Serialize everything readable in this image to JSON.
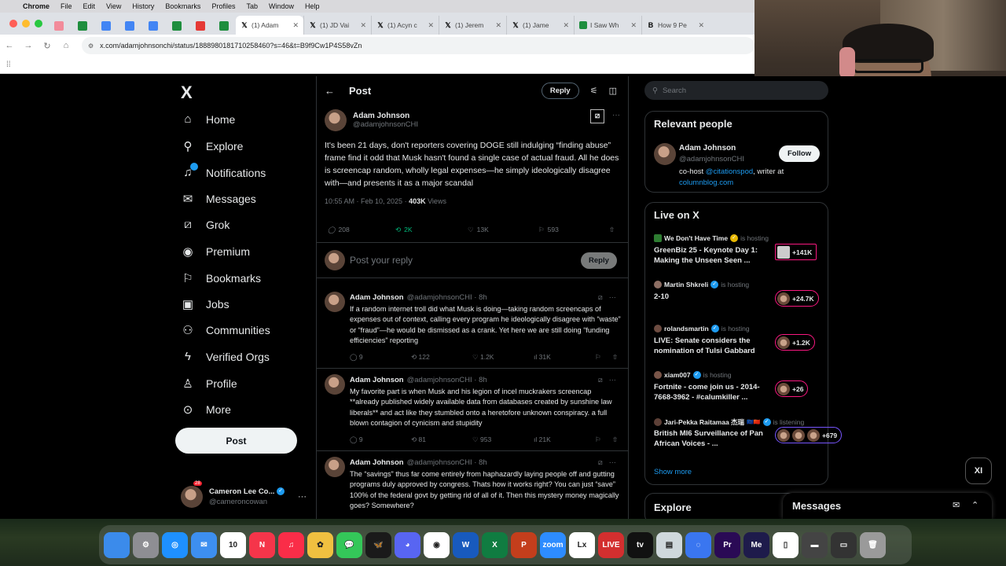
{
  "menubar": {
    "apple": "",
    "items": [
      "Chrome",
      "File",
      "Edit",
      "View",
      "History",
      "Bookmarks",
      "Profiles",
      "Tab",
      "Window",
      "Help"
    ]
  },
  "browser": {
    "tabs": [
      {
        "title": "(1) Adam",
        "active": true
      },
      {
        "title": "(1) JD Vai",
        "active": false
      },
      {
        "title": "(1) Acyn c",
        "active": false
      },
      {
        "title": "(1) Jerem",
        "active": false
      },
      {
        "title": "(1) Jame",
        "active": false
      },
      {
        "title": "I Saw Wh",
        "active": false
      },
      {
        "title": "How 9 Pe",
        "active": false
      }
    ],
    "url": "x.com/adamjohnsonchi/status/1888980181710258460?s=46&t=B9f9Cw1P4S58vZn"
  },
  "nav": {
    "logo": "X",
    "items": [
      {
        "label": "Home",
        "icon": "home-icon",
        "glyph": "⌂"
      },
      {
        "label": "Explore",
        "icon": "search-icon",
        "glyph": "⚲"
      },
      {
        "label": "Notifications",
        "icon": "bell-icon",
        "glyph": "🔔"
      },
      {
        "label": "Messages",
        "icon": "envelope-icon",
        "glyph": "✉"
      },
      {
        "label": "Grok",
        "icon": "grok-icon",
        "glyph": "⧄"
      },
      {
        "label": "Premium",
        "icon": "premium-icon",
        "glyph": "◉"
      },
      {
        "label": "Bookmarks",
        "icon": "bookmark-icon",
        "glyph": "⚑"
      },
      {
        "label": "Jobs",
        "icon": "briefcase-icon",
        "glyph": "▣"
      },
      {
        "label": "Communities",
        "icon": "communities-icon",
        "glyph": "⚇"
      },
      {
        "label": "Verified Orgs",
        "icon": "lightning-icon",
        "glyph": "ϟ"
      },
      {
        "label": "Profile",
        "icon": "person-icon",
        "glyph": "⚲"
      },
      {
        "label": "More",
        "icon": "more-circle-icon",
        "glyph": "⊙"
      }
    ],
    "post_label": "Post",
    "account": {
      "name": "Cameron Lee Co...",
      "handle": "@cameroncowan",
      "notif_count": "28"
    }
  },
  "main": {
    "title": "Post",
    "reply_label": "Reply",
    "tweet": {
      "name": "Adam Johnson",
      "handle": "@adamjohnsonCHI",
      "text": "It's been 21 days, don't reporters covering DOGE still indulging “finding abuse” frame find it odd that Musk hasn't found a single case of actual fraud. All he does is screencap random, wholly legal expenses—he simply ideologically disagree with—and presents it as a major scandal",
      "time": "10:55 AM · Feb 10, 2025 · ",
      "views": "403K",
      "views_label": " Views",
      "replies": "208",
      "reposts": "2K",
      "likes": "13K",
      "bookmarks": "593"
    },
    "composer": {
      "placeholder": "Post your reply",
      "button": "Reply"
    },
    "replies": [
      {
        "name": "Adam Johnson",
        "handle": "@adamjohnsonCHI · 8h",
        "text": "If a random internet troll did what Musk is doing—taking random screencaps of expenses out of context, calling every program he ideologically disagree with “waste” or “fraud”—he would be dismissed as a crank. Yet here we are still doing “funding efficiencies” reporting",
        "replies": "9",
        "reposts": "122",
        "likes": "1.2K",
        "views": "31K"
      },
      {
        "name": "Adam Johnson",
        "handle": "@adamjohnsonCHI · 8h",
        "text": "My favorite part is when Musk and his legion of incel muckrakers screencap **already published widely available data from databases created by sunshine law liberals** and act like they stumbled onto a heretofore unknown conspiracy. a full blown contagion of cynicism and stupidity",
        "replies": "9",
        "reposts": "81",
        "likes": "953",
        "views": "21K"
      },
      {
        "name": "Adam Johnson",
        "handle": "@adamjohnsonCHI · 8h",
        "text": "The “savings” thus far come entirely from haphazardly laying people off and gutting programs duly approved by congress. Thats how it works right? You can just “save” 100% of the federal govt by getting rid of all of it. Then this mystery money magically goes? Somewhere?",
        "replies": "",
        "reposts": "",
        "likes": "",
        "views": ""
      }
    ]
  },
  "right": {
    "search_placeholder": "Search",
    "relevant": {
      "heading": "Relevant people",
      "name": "Adam Johnson",
      "handle": "@adamjohnsonCHI",
      "follow": "Follow",
      "bio_prefix": "co-host ",
      "bio_link1": "@citationspod",
      "bio_mid": ", writer at",
      "bio_link2": "columnblog.com"
    },
    "live": {
      "heading": "Live on X",
      "items": [
        {
          "host": "We Don't Have Time",
          "status": "is hosting",
          "title": "GreenBiz 25 - Keynote Day 1: Making the Unseen Seen ...",
          "count": "+141K",
          "color": "pink"
        },
        {
          "host": "Martin Shkreli",
          "status": "is hosting",
          "title": "2-10",
          "count": "+24.7K",
          "color": "pink"
        },
        {
          "host": "rolandsmartin",
          "status": "is hosting",
          "title": "LIVE: Senate considers the nomination of Tulsi Gabbard",
          "count": "+1.2K",
          "color": "pink"
        },
        {
          "host": "xiam007",
          "status": "is hosting",
          "title": "Fortnite - come join us - 2014-7668-3962 - #calumkiller ...",
          "count": "+26",
          "color": "pink"
        },
        {
          "host": "Jari-Pekka Raitamaa 杰瑞",
          "status": "is listening",
          "title": "British MI6 Surveillance of Pan African Voices - ...",
          "count": "+679",
          "color": "purple"
        }
      ],
      "show_more": "Show more"
    },
    "explore": "Explore",
    "messages": "Messages"
  },
  "grok_fab": "XI",
  "dock": [
    {
      "name": "finder-icon",
      "color": "#3b8beb",
      "label": ""
    },
    {
      "name": "settings-icon",
      "color": "#8e8e93",
      "label": "⚙"
    },
    {
      "name": "safari-icon",
      "color": "#1e90ff",
      "label": "◎"
    },
    {
      "name": "mail-icon",
      "color": "#3d8ff0",
      "label": "✉"
    },
    {
      "name": "calendar-icon",
      "color": "#ffffff",
      "label": "10"
    },
    {
      "name": "news-icon",
      "color": "#f5354a",
      "label": "N"
    },
    {
      "name": "music-icon",
      "color": "#fa2d48",
      "label": "♫"
    },
    {
      "name": "photos-icon",
      "color": "#f0c040",
      "label": "✿"
    },
    {
      "name": "messages-icon",
      "color": "#34c759",
      "label": "💬"
    },
    {
      "name": "butterfly-icon",
      "color": "#1a1a1a",
      "label": "🦋"
    },
    {
      "name": "discord-icon",
      "color": "#5865f2",
      "label": "◕"
    },
    {
      "name": "chrome-icon",
      "color": "#ffffff",
      "label": "◉"
    },
    {
      "name": "word-icon",
      "color": "#185abd",
      "label": "W"
    },
    {
      "name": "excel-icon",
      "color": "#107c41",
      "label": "X"
    },
    {
      "name": "powerpoint-icon",
      "color": "#c43e1c",
      "label": "P"
    },
    {
      "name": "zoom-icon",
      "color": "#2d8cff",
      "label": "zoom"
    },
    {
      "name": "lx-icon",
      "color": "#ffffff",
      "label": "Lx"
    },
    {
      "name": "live-icon",
      "color": "#d32f2f",
      "label": "LIVE"
    },
    {
      "name": "appletv-icon",
      "color": "#111111",
      "label": "tv"
    },
    {
      "name": "preview-icon",
      "color": "#cfd8dc",
      "label": "▤"
    },
    {
      "name": "signal-icon",
      "color": "#3a76f0",
      "label": "◌"
    },
    {
      "name": "premiere-icon",
      "color": "#2a0a55",
      "label": "Pr"
    },
    {
      "name": "media-encoder-icon",
      "color": "#1e1b4b",
      "label": "Me"
    },
    {
      "name": "document-icon",
      "color": "#ffffff",
      "label": "▯"
    },
    {
      "name": "folder-icon",
      "color": "#444444",
      "label": "▬"
    },
    {
      "name": "screen-icon",
      "color": "#333333",
      "label": "▭"
    },
    {
      "name": "trash-icon",
      "color": "#9a9a9a",
      "label": "🗑"
    }
  ]
}
